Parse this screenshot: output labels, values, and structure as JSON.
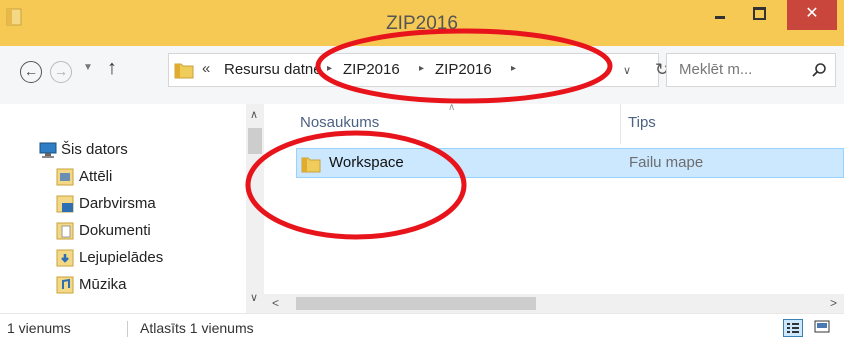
{
  "window": {
    "title": "ZIP2016",
    "minimize_icon": "minimize-icon",
    "maximize_icon": "maximize-icon",
    "close_label": "✕"
  },
  "nav": {
    "back_label": "←",
    "forward_label": "→",
    "history_label": "▼",
    "up_label": "↑"
  },
  "address": {
    "overflow_label": "«",
    "crumbs": [
      "Resursu datne",
      "ZIP2016",
      "ZIP2016"
    ],
    "separator": "▸",
    "dropdown_label": "∨",
    "refresh_label": "↻"
  },
  "search": {
    "placeholder": "Meklēt m..."
  },
  "nav_pane": {
    "items": [
      {
        "label": "Šis dators",
        "icon": "computer-icon"
      },
      {
        "label": "Attēli",
        "icon": "pictures-icon"
      },
      {
        "label": "Darbvirsma",
        "icon": "desktop-icon"
      },
      {
        "label": "Dokumenti",
        "icon": "documents-icon"
      },
      {
        "label": "Lejupielādes",
        "icon": "downloads-icon"
      },
      {
        "label": "Mūzika",
        "icon": "music-icon"
      }
    ]
  },
  "columns": {
    "name": "Nosaukums",
    "type": "Tips"
  },
  "files": [
    {
      "name": "Workspace",
      "type": "Failu mape",
      "icon": "folder-icon"
    }
  ],
  "status": {
    "count": "1 vienums",
    "selected": "Atlasīts 1 vienums"
  },
  "colors": {
    "titlebar": "#f6c955",
    "selection": "#cce8ff",
    "annotation": "#e8141b",
    "close_button": "#c9463d"
  }
}
